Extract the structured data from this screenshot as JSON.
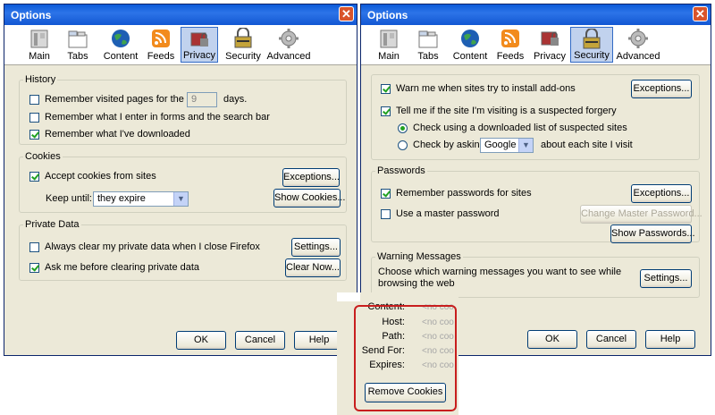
{
  "left_window": {
    "title": "Options",
    "toolbar": [
      "Main",
      "Tabs",
      "Content",
      "Feeds",
      "Privacy",
      "Security",
      "Advanced"
    ],
    "selected_pane": "Privacy",
    "history": {
      "label": "History",
      "remember_visited": "Remember visited pages for the last",
      "days_value": "9",
      "days_unit": "days.",
      "remember_forms": "Remember what I enter in forms and the search bar",
      "remember_downloads": "Remember what I've downloaded"
    },
    "cookies": {
      "label": "Cookies",
      "accept": "Accept cookies from sites",
      "exceptions_button": "Exceptions...",
      "keep_until_label": "Keep until:",
      "keep_until_value": "they expire",
      "show_cookies_button": "Show Cookies..."
    },
    "private_data": {
      "label": "Private Data",
      "always_clear": "Always clear my private data when I close Firefox",
      "settings_button": "Settings...",
      "ask_before": "Ask me before clearing private data",
      "clear_now_button": "Clear Now..."
    },
    "buttons": {
      "ok": "OK",
      "cancel": "Cancel",
      "help": "Help"
    }
  },
  "right_window": {
    "title": "Options",
    "toolbar": [
      "Main",
      "Tabs",
      "Content",
      "Feeds",
      "Privacy",
      "Security",
      "Advanced"
    ],
    "selected_pane": "Security",
    "addons": {
      "warn_addons": "Warn me when sites try to install add-ons",
      "exceptions_button": "Exceptions...",
      "forgery": "Tell me if the site I'm visiting is a suspected forgery",
      "check_list": "Check using a downloaded list of suspected sites",
      "check_asking": "Check by asking",
      "provider": "Google",
      "about_each": "about each site I visit"
    },
    "passwords": {
      "label": "Passwords",
      "remember": "Remember passwords for sites",
      "exceptions_button": "Exceptions...",
      "master": "Use a master password",
      "change_master_button": "Change Master Password...",
      "show_passwords_button": "Show Passwords..."
    },
    "warnings": {
      "label": "Warning Messages",
      "description": "Choose which warning messages you want to see while browsing the web",
      "settings_button": "Settings..."
    },
    "buttons": {
      "ok": "OK",
      "cancel": "Cancel",
      "help": "Help"
    }
  },
  "cookie_details": {
    "fields": [
      {
        "label": "Content:",
        "value": "<no coo"
      },
      {
        "label": "Host:",
        "value": "<no coo"
      },
      {
        "label": "Path:",
        "value": "<no coo"
      },
      {
        "label": "Send For:",
        "value": "<no coo"
      },
      {
        "label": "Expires:",
        "value": "<no coo"
      }
    ],
    "remove_button": "Remove Cookies",
    "highlight_color": "#c81e1e"
  }
}
